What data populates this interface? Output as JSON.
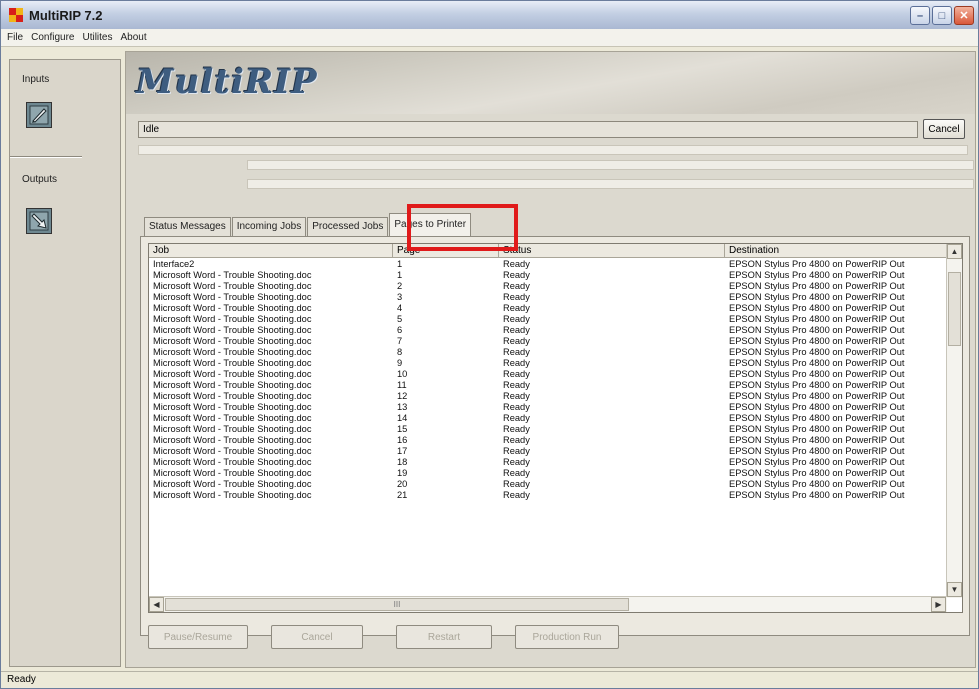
{
  "window": {
    "title": "MultiRIP 7.2",
    "minimize": "–",
    "maximize": "□",
    "close": "✕"
  },
  "menu": [
    "File",
    "Configure",
    "Utilites",
    "About"
  ],
  "left_panel": {
    "inputs_label": "Inputs",
    "outputs_label": "Outputs"
  },
  "logo": "MultiRIP",
  "status": {
    "idle_text": "Idle",
    "cancel_label": "Cancel"
  },
  "tabs": [
    {
      "label": "Status Messages",
      "active": false
    },
    {
      "label": "Incoming Jobs",
      "active": false
    },
    {
      "label": "Processed Jobs",
      "active": false
    },
    {
      "label": "Pages to Printer",
      "active": true
    }
  ],
  "table": {
    "columns": [
      "Job",
      "Page",
      "Status",
      "Destination"
    ],
    "rows": [
      [
        "Interface2",
        "1",
        "Ready",
        "EPSON Stylus Pro 4800 on PowerRIP Out"
      ],
      [
        "Microsoft Word - Trouble Shooting.doc",
        "1",
        "Ready",
        "EPSON Stylus Pro 4800 on PowerRIP Out"
      ],
      [
        "Microsoft Word - Trouble Shooting.doc",
        "2",
        "Ready",
        "EPSON Stylus Pro 4800 on PowerRIP Out"
      ],
      [
        "Microsoft Word - Trouble Shooting.doc",
        "3",
        "Ready",
        "EPSON Stylus Pro 4800 on PowerRIP Out"
      ],
      [
        "Microsoft Word - Trouble Shooting.doc",
        "4",
        "Ready",
        "EPSON Stylus Pro 4800 on PowerRIP Out"
      ],
      [
        "Microsoft Word - Trouble Shooting.doc",
        "5",
        "Ready",
        "EPSON Stylus Pro 4800 on PowerRIP Out"
      ],
      [
        "Microsoft Word - Trouble Shooting.doc",
        "6",
        "Ready",
        "EPSON Stylus Pro 4800 on PowerRIP Out"
      ],
      [
        "Microsoft Word - Trouble Shooting.doc",
        "7",
        "Ready",
        "EPSON Stylus Pro 4800 on PowerRIP Out"
      ],
      [
        "Microsoft Word - Trouble Shooting.doc",
        "8",
        "Ready",
        "EPSON Stylus Pro 4800 on PowerRIP Out"
      ],
      [
        "Microsoft Word - Trouble Shooting.doc",
        "9",
        "Ready",
        "EPSON Stylus Pro 4800 on PowerRIP Out"
      ],
      [
        "Microsoft Word - Trouble Shooting.doc",
        "10",
        "Ready",
        "EPSON Stylus Pro 4800 on PowerRIP Out"
      ],
      [
        "Microsoft Word - Trouble Shooting.doc",
        "11",
        "Ready",
        "EPSON Stylus Pro 4800 on PowerRIP Out"
      ],
      [
        "Microsoft Word - Trouble Shooting.doc",
        "12",
        "Ready",
        "EPSON Stylus Pro 4800 on PowerRIP Out"
      ],
      [
        "Microsoft Word - Trouble Shooting.doc",
        "13",
        "Ready",
        "EPSON Stylus Pro 4800 on PowerRIP Out"
      ],
      [
        "Microsoft Word - Trouble Shooting.doc",
        "14",
        "Ready",
        "EPSON Stylus Pro 4800 on PowerRIP Out"
      ],
      [
        "Microsoft Word - Trouble Shooting.doc",
        "15",
        "Ready",
        "EPSON Stylus Pro 4800 on PowerRIP Out"
      ],
      [
        "Microsoft Word - Trouble Shooting.doc",
        "16",
        "Ready",
        "EPSON Stylus Pro 4800 on PowerRIP Out"
      ],
      [
        "Microsoft Word - Trouble Shooting.doc",
        "17",
        "Ready",
        "EPSON Stylus Pro 4800 on PowerRIP Out"
      ],
      [
        "Microsoft Word - Trouble Shooting.doc",
        "18",
        "Ready",
        "EPSON Stylus Pro 4800 on PowerRIP Out"
      ],
      [
        "Microsoft Word - Trouble Shooting.doc",
        "19",
        "Ready",
        "EPSON Stylus Pro 4800 on PowerRIP Out"
      ],
      [
        "Microsoft Word - Trouble Shooting.doc",
        "20",
        "Ready",
        "EPSON Stylus Pro 4800 on PowerRIP Out"
      ],
      [
        "Microsoft Word - Trouble Shooting.doc",
        "21",
        "Ready",
        "EPSON Stylus Pro 4800 on PowerRIP Out"
      ]
    ]
  },
  "scroll": {
    "up": "▲",
    "down": "▼",
    "left": "◀",
    "right": "▶",
    "thumb_grip": "III"
  },
  "actions": {
    "pause_resume": "Pause/Resume",
    "cancel": "Cancel",
    "restart": "Restart",
    "production_run": "Production Run"
  },
  "statusbar": "Ready",
  "icons": {
    "inputs": "input-pen-icon",
    "outputs": "output-printer-icon",
    "app": "multirip-app-icon"
  },
  "colors": {
    "highlight": "#e01a1a",
    "logo": "#3e5d80"
  }
}
